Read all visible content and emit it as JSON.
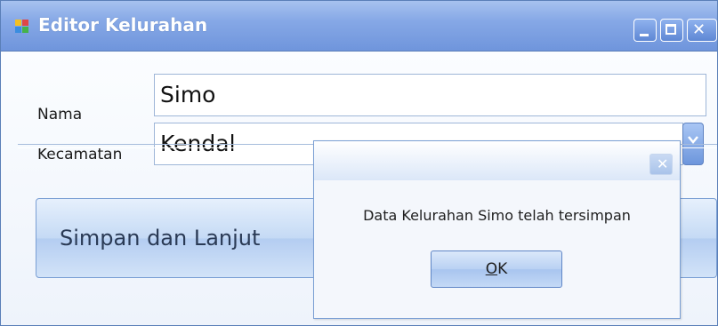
{
  "window": {
    "title": "Editor Kelurahan",
    "icon": "app-window-icon",
    "controls": [
      "minimize-icon",
      "maximize-icon",
      "close-icon"
    ]
  },
  "form": {
    "nama_label": "Nama",
    "nama_value": "Simo",
    "kecamatan_label": "Kecamatan",
    "kecamatan_value": "Kendal",
    "kecamatan_dropdown_icon": "chevron-down-icon",
    "save_continue_label": "Simpan dan Lanjut"
  },
  "message_box": {
    "close_icon": "close-icon",
    "text": "Data Kelurahan Simo telah tersimpan",
    "ok_accel": "O",
    "ok_rest": "K"
  },
  "colors": {
    "titlebar": "#86a8e6",
    "button_gradient": "#c5daf5",
    "text": "#1a1a1a"
  }
}
